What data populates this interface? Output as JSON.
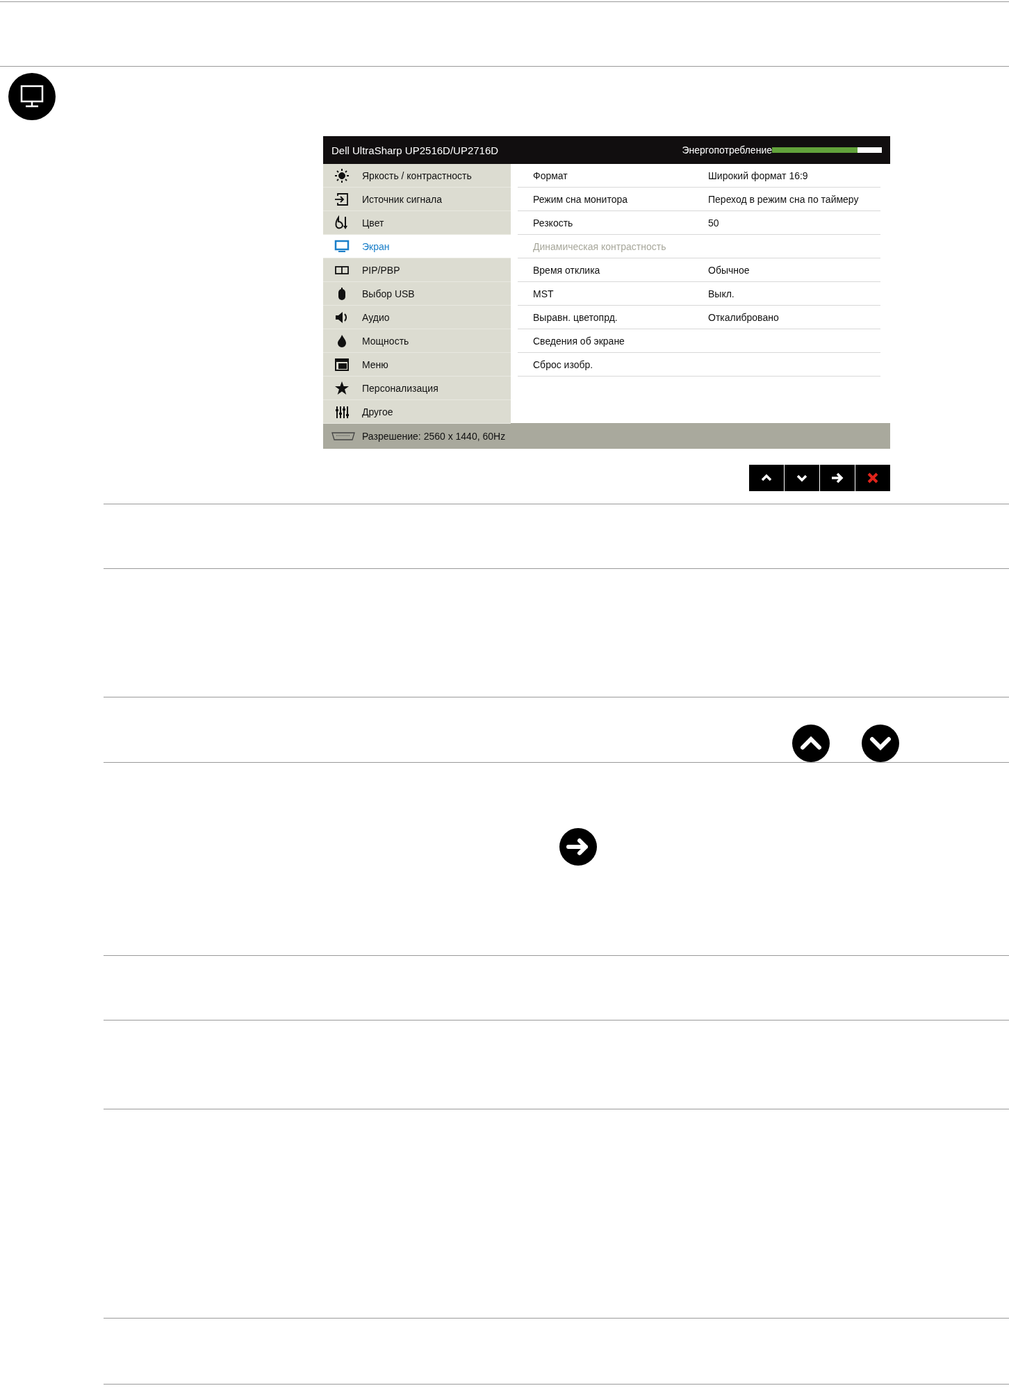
{
  "osd": {
    "title": "Dell UltraSharp UP2516D/UP2716D",
    "power_label": "Энергопотребление",
    "power": {
      "level": 0.78
    },
    "menu": [
      {
        "label": "Яркость / контрастность",
        "selected": false
      },
      {
        "label": "Источник сигнала",
        "selected": false
      },
      {
        "label": "Цвет",
        "selected": false
      },
      {
        "label": "Экран",
        "selected": true
      },
      {
        "label": "PIP/PBP",
        "selected": false
      },
      {
        "label": "Выбор USB",
        "selected": false
      },
      {
        "label": "Аудио",
        "selected": false
      },
      {
        "label": "Мощность",
        "selected": false
      },
      {
        "label": "Меню",
        "selected": false
      },
      {
        "label": "Персонализация",
        "selected": false
      },
      {
        "label": "Другое",
        "selected": false
      }
    ],
    "settings": [
      {
        "label": "Формат",
        "value": "Широкий формат 16:9",
        "disabled": false
      },
      {
        "label": "Режим сна монитора",
        "value": "Переход в режим сна по таймеру",
        "disabled": false
      },
      {
        "label": "Резкость",
        "value": "50",
        "disabled": false
      },
      {
        "label": "Динамическая контрастность",
        "disabled": true
      },
      {
        "label": "Время отклика",
        "value": "Обычное",
        "disabled": false
      },
      {
        "label": "MST",
        "value": "Выкл.",
        "disabled": false
      },
      {
        "label": "Выравн. цветопрд.",
        "value": "Откалибровано",
        "disabled": false
      },
      {
        "label": "Сведения об экране",
        "disabled": false
      },
      {
        "label": "Сброс изобр.",
        "disabled": false
      }
    ],
    "status": "Разрешение: 2560 x 1440, 60Hz"
  }
}
